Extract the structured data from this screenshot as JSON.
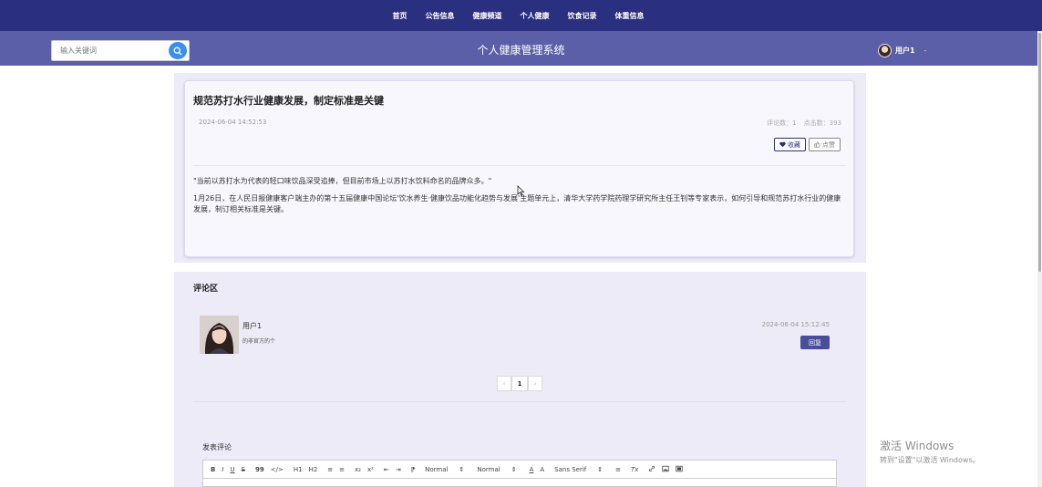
{
  "nav": {
    "items": [
      "首页",
      "公告信息",
      "健康频道",
      "个人健康",
      "饮食记录",
      "体重信息"
    ]
  },
  "header": {
    "search_placeholder": "输入关键词",
    "title": "个人健康管理系统",
    "user_name": "用户1",
    "caret": "-"
  },
  "article": {
    "title": "规范苏打水行业健康发展，制定标准是关键",
    "date": "2024-06-04 14:52:53",
    "comment_count": "评论数：1",
    "click_count": "点击数：393",
    "fav_label": "收藏",
    "like_label": "点赞",
    "paragraphs": [
      "\"当前以苏打水为代表的轻口味饮品深受追捧，但目前市场上以苏打水饮料命名的品牌众多。\"",
      "1月26日，在人民日报健康客户端主办的第十五届健康中国论坛'饮水养生·健康饮品功能化趋势与发展'主题单元上，清华大学药学院药理学研究所主任王钊等专家表示，如何引导和规范苏打水行业的健康发展，制订相关标准是关键。"
    ]
  },
  "comments": {
    "title": "评论区",
    "items": [
      {
        "user": "用户1",
        "text": "的非官方的个",
        "time": "2024-06-04 15:12:45",
        "reply_label": "回复"
      }
    ],
    "pager": {
      "prev": "‹",
      "current": "1",
      "next": "›"
    },
    "post_label": "发表评论",
    "toolbar": {
      "bold": "B",
      "italic": "I",
      "underline": "U",
      "strike": "S",
      "quote": "99",
      "code": "</>",
      "h1": "H1",
      "h2": "H2",
      "ol": "≡",
      "ul": "≡",
      "sub": "x₂",
      "sup": "x²",
      "outdent": "⇤",
      "indent": "⇥",
      "rtl": "⁋",
      "size_value": "Normal",
      "header_value": "Normal",
      "font_color": "A",
      "bg_color": "A",
      "font_value": "Sans Serif",
      "align": "≡",
      "clean": "Tx"
    }
  },
  "watermark": {
    "line1": "激活 Windows",
    "line2": "转到\"设置\"以激活 Windows。"
  },
  "colors": {
    "nav_bg": "#2b2f7f",
    "header_bg": "#5a5fa8",
    "panel_bg": "#ecebf7",
    "accent": "#3b8ff0"
  }
}
